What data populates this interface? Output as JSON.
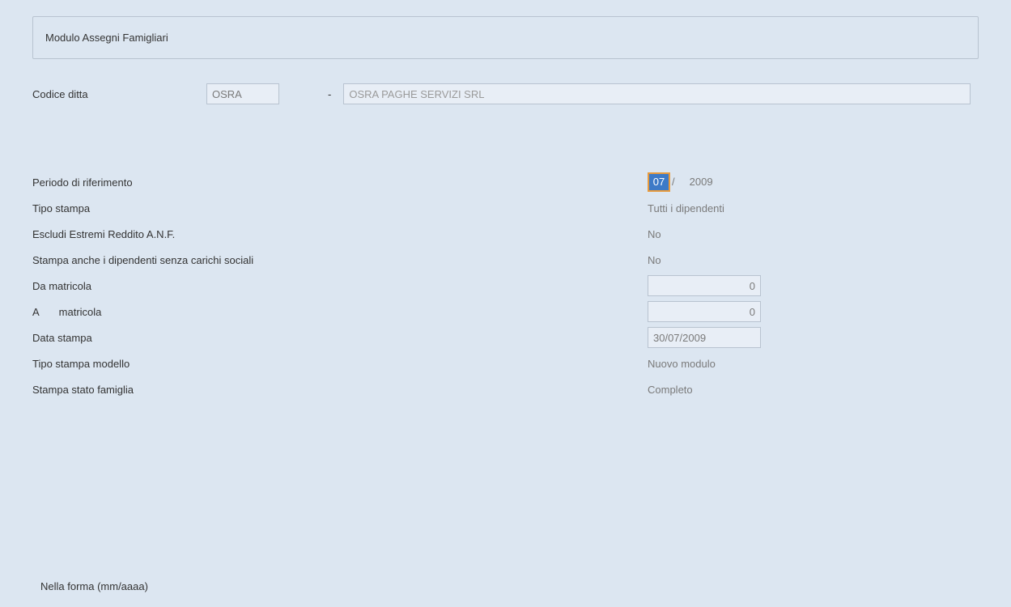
{
  "title": "Modulo Assegni Famigliari",
  "company": {
    "label": "Codice ditta",
    "code": "OSRA",
    "separator": "-",
    "name": "OSRA PAGHE SERVIZI SRL"
  },
  "fields": {
    "periodo": {
      "label": "Periodo di riferimento",
      "month": "07",
      "slash": "/",
      "year": "2009"
    },
    "tipo_stampa": {
      "label": "Tipo stampa",
      "value": "Tutti i dipendenti"
    },
    "escludi_estremi": {
      "label": "Escludi Estremi Reddito A.N.F.",
      "value": "No"
    },
    "stampa_senza_carichi": {
      "label": "Stampa anche i dipendenti senza carichi sociali",
      "value": "No"
    },
    "da_matricola": {
      "label": "Da matricola",
      "value": "0"
    },
    "a_matricola": {
      "label_prefix": "A",
      "label_suffix": "matricola",
      "value": "0"
    },
    "data_stampa": {
      "label": "Data stampa",
      "value": "30/07/2009"
    },
    "tipo_stampa_modello": {
      "label": "Tipo stampa modello",
      "value": "Nuovo modulo"
    },
    "stampa_stato_famiglia": {
      "label": "Stampa stato famiglia",
      "value": "Completo"
    }
  },
  "hint": "Nella forma (mm/aaaa)"
}
